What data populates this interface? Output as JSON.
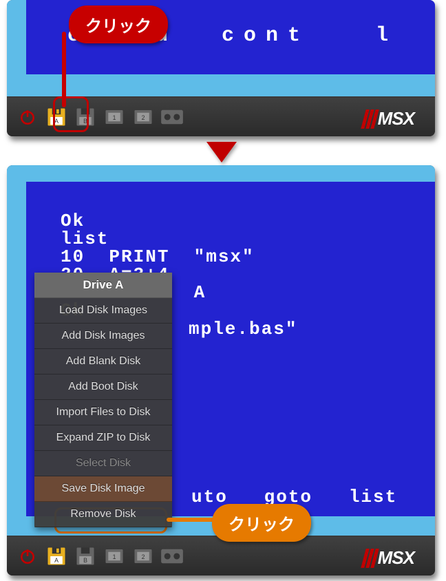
{
  "callouts": {
    "top": "クリック",
    "bottom": "クリック"
  },
  "screen_top": {
    "fnkeys_fragment": "cload  cont   l"
  },
  "screen_bottom": {
    "program": "Ok\nlist\n10  PRINT  \"msx\"\n20  A=3+4\n30  PRINT  A\nOk",
    "save_fragment": "mple.bas\"",
    "fnkeys_fragment": "uto   goto   list   ru"
  },
  "menu": {
    "header": "Drive A",
    "items": [
      {
        "label": "Load Disk Images",
        "disabled": false
      },
      {
        "label": "Add Disk Images",
        "disabled": false
      },
      {
        "label": "Add Blank Disk",
        "disabled": false
      },
      {
        "label": "Add Boot Disk",
        "disabled": false
      },
      {
        "label": "Import Files to Disk",
        "disabled": false
      },
      {
        "label": "Expand ZIP to Disk",
        "disabled": false
      },
      {
        "label": "Select Disk",
        "disabled": true
      },
      {
        "label": "Save Disk Image",
        "disabled": false,
        "highlighted": true
      },
      {
        "label": "Remove Disk",
        "disabled": false
      }
    ]
  },
  "toolbar": {
    "icons": [
      "power",
      "floppy-a",
      "floppy-b",
      "cart-1",
      "cart-2",
      "cassette"
    ],
    "logo": "MSX"
  }
}
